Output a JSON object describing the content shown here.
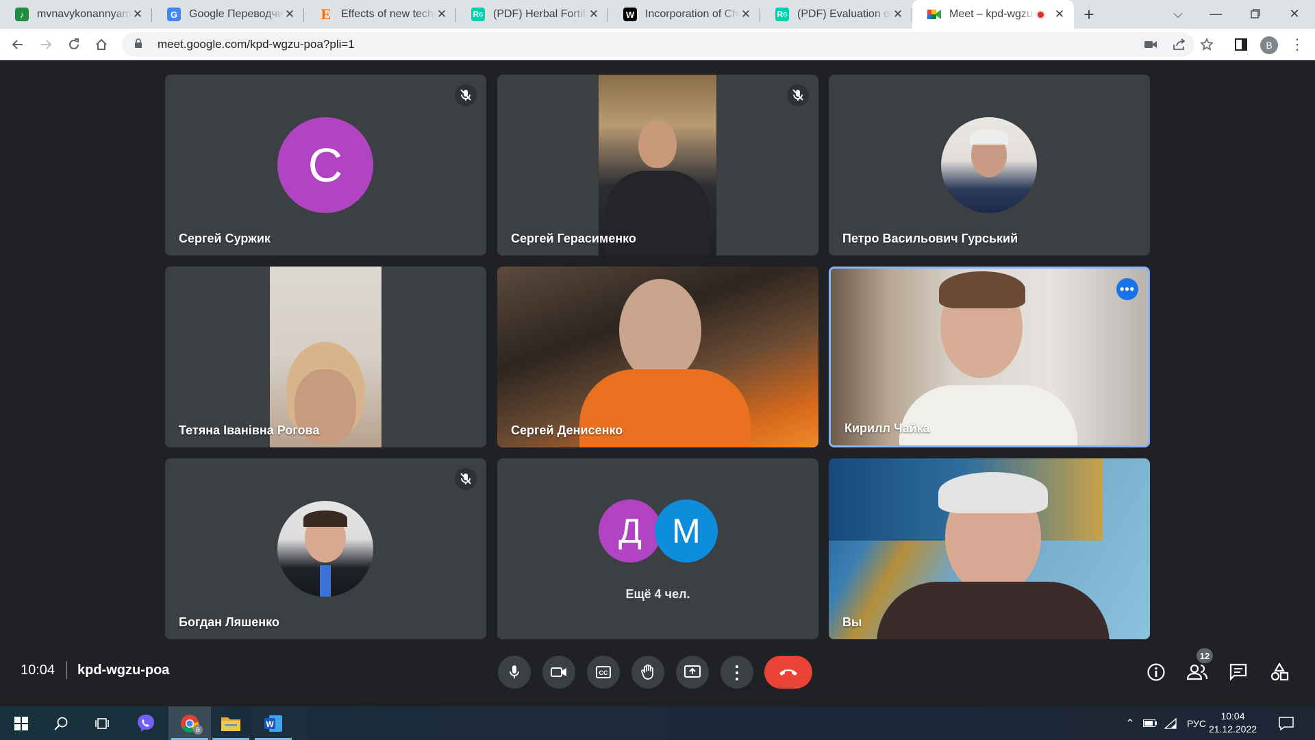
{
  "browser": {
    "tabs": [
      {
        "title": "mvnavykonannyamag",
        "favicon": "music-note-icon",
        "color": "#1e8e3e"
      },
      {
        "title": "Google Переводчик",
        "favicon": "translate-icon",
        "color": "#4285f4"
      },
      {
        "title": "Effects of new technol",
        "favicon": "elsevier-e-icon",
        "color": "#ff6c00"
      },
      {
        "title": "(PDF) Herbal Fortificat",
        "favicon": "researchgate-icon",
        "color": "#00d0af"
      },
      {
        "title": "Incorporation of Chlo",
        "favicon": "wiley-w-icon",
        "color": "#000000"
      },
      {
        "title": "(PDF) Evaluation of th",
        "favicon": "researchgate-icon",
        "color": "#00d0af"
      },
      {
        "title": "Meet – kpd-wgzu",
        "favicon": "meet-icon",
        "color": "#00832d",
        "active": true,
        "recording": true
      }
    ],
    "url": "meet.google.com/kpd-wgzu-poa?pli=1",
    "profile_initial": "B"
  },
  "meet": {
    "participants": [
      {
        "name": "Сергей Суржик",
        "type": "letter",
        "letter": "С",
        "color": "#b044c2",
        "muted": true
      },
      {
        "name": "Сергей Герасименко",
        "type": "video",
        "muted": true
      },
      {
        "name": "Петро Васильович Гурський",
        "type": "photo",
        "muted": false
      },
      {
        "name": "Тетяна Іванівна Рогова",
        "type": "video",
        "muted": false
      },
      {
        "name": "Сергей Денисенко",
        "type": "video",
        "muted": false
      },
      {
        "name": "Кирилл Чайка",
        "type": "video",
        "muted": false,
        "speaking": true
      },
      {
        "name": "Богдан Ляшенко",
        "type": "photo",
        "muted": true
      },
      {
        "name": "Ещё 4 чел.",
        "type": "group",
        "letters": [
          "Д",
          "М"
        ],
        "colors": [
          "#b044c2",
          "#0d8ddb"
        ]
      },
      {
        "name": "Вы",
        "type": "video",
        "muted": false
      }
    ],
    "time": "10:04",
    "meeting_code": "kpd-wgzu-poa",
    "participants_count": "12",
    "accent": "#8ab4f8",
    "hangup_color": "#ea4335"
  },
  "taskbar": {
    "apps": [
      "windows-start-icon",
      "search-icon",
      "task-view-icon",
      "viber-icon",
      "chrome-icon",
      "file-explorer-icon",
      "word-icon"
    ],
    "chrome_badge": "B",
    "language": "РУС",
    "clock_time": "10:04",
    "clock_date": "21.12.2022"
  }
}
